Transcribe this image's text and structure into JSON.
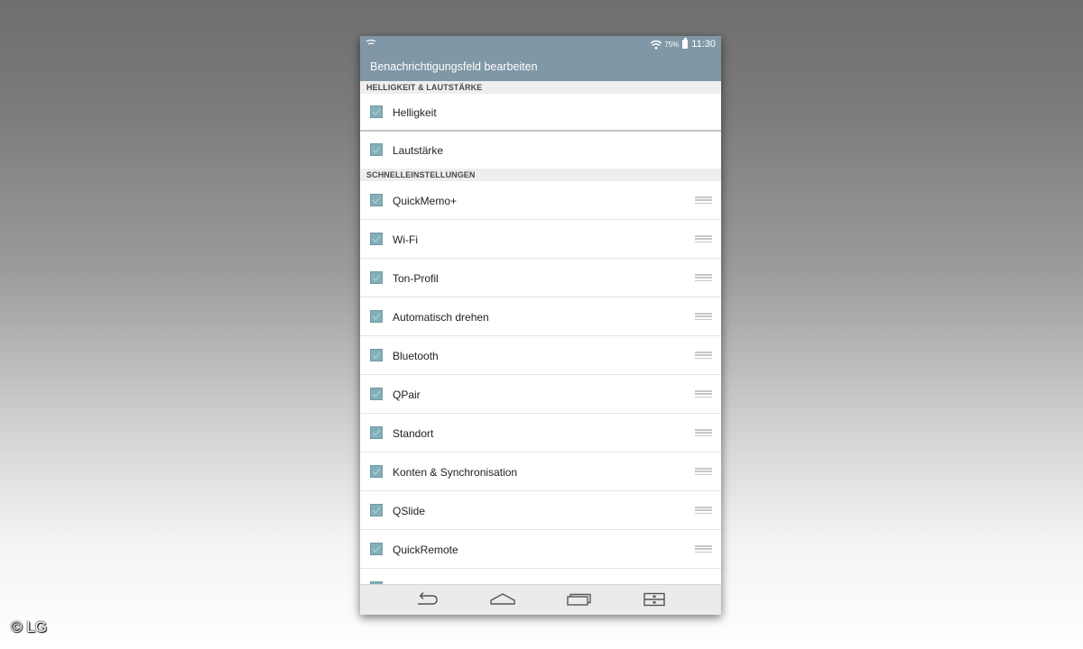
{
  "status_bar": {
    "battery_percent": "75%",
    "time": "11:30",
    "icons": [
      "notification-icon",
      "wifi-icon",
      "battery-icon"
    ]
  },
  "app_bar": {
    "title": "Benachrichtigungsfeld bearbeiten"
  },
  "sections": {
    "brightness_volume": {
      "header": "HELLIGKEIT & LAUTSTÄRKE",
      "items": [
        {
          "label": "Helligkeit",
          "checked": true
        },
        {
          "label": "Lautstärke",
          "checked": true
        }
      ]
    },
    "quick_settings": {
      "header": "SCHNELLEINSTELLUNGEN",
      "items": [
        {
          "label": "QuickMemo+",
          "checked": true
        },
        {
          "label": "Wi-Fi",
          "checked": true
        },
        {
          "label": "Ton-Profil",
          "checked": true
        },
        {
          "label": "Automatisch drehen",
          "checked": true
        },
        {
          "label": "Bluetooth",
          "checked": true
        },
        {
          "label": "QPair",
          "checked": true
        },
        {
          "label": "Standort",
          "checked": true
        },
        {
          "label": "Konten & Synchronisation",
          "checked": true
        },
        {
          "label": "QSlide",
          "checked": true
        },
        {
          "label": "QuickRemote",
          "checked": true
        }
      ]
    }
  },
  "nav_bar": {
    "icons": [
      "back-icon",
      "home-icon",
      "recent-apps-icon",
      "dual-window-icon"
    ]
  },
  "copyright": "© LG",
  "colors": {
    "accent": "#7f97a6",
    "checkbox": "#84afb8"
  }
}
